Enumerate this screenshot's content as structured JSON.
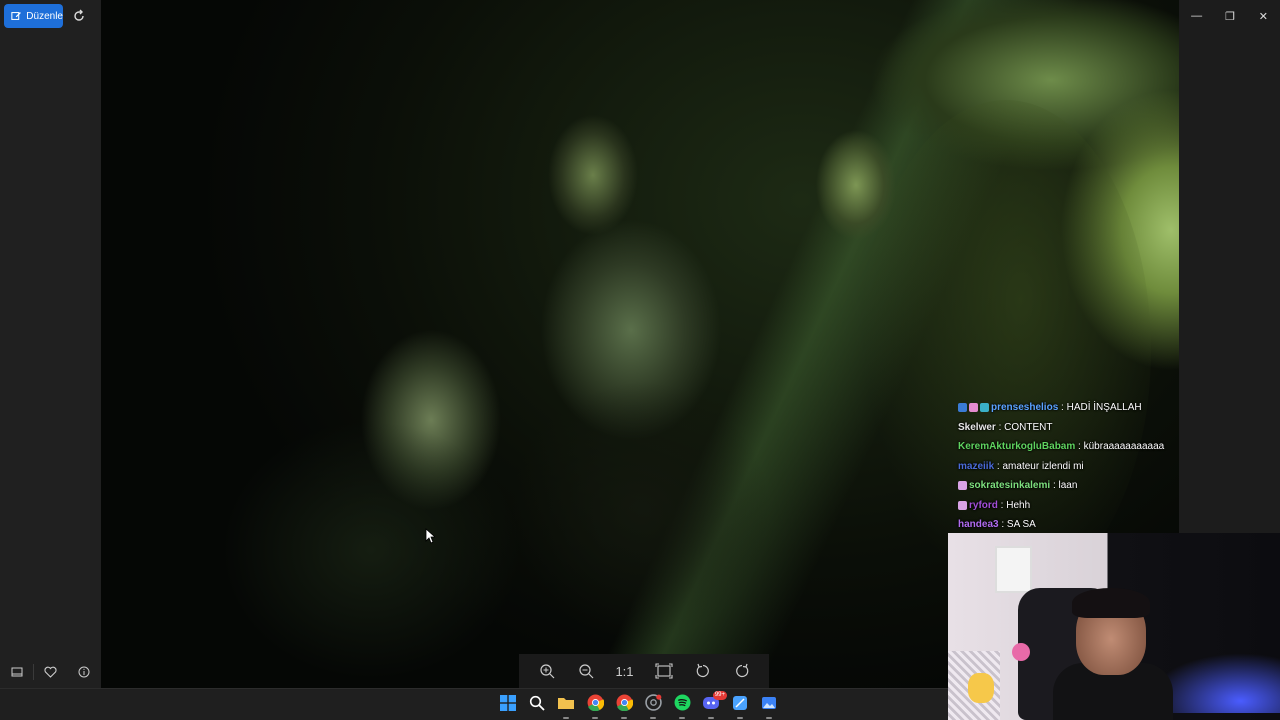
{
  "toolbar": {
    "edit_label": "Düzenle"
  },
  "chat": {
    "lines": [
      {
        "user": "prenseshelios",
        "separator": ":",
        "message": "HADİ İNŞALLAH",
        "color": "#5aa2ff",
        "badges": [
          "#3a7bd5",
          "#e58bd0",
          "#3ab0c8"
        ]
      },
      {
        "user": "Skelwer",
        "separator": ":",
        "message": "CONTENT",
        "color": "#e6e6e6",
        "badges": []
      },
      {
        "user": "KeremAkturkogluBabam",
        "separator": ":",
        "message": "kübraaaaaaaaaaa",
        "color": "#5fd35f",
        "badges": []
      },
      {
        "user": "mazeiik",
        "separator": ":",
        "message": "amateur izlendi mi",
        "color": "#4a6bd8",
        "badges": []
      },
      {
        "user": "sokratesinkalemi",
        "separator": ":",
        "message": "laan",
        "color": "#7ee07e",
        "badges": [
          "#d9a3e6"
        ]
      },
      {
        "user": "ryford",
        "separator": ":",
        "message": "Hehh",
        "color": "#a24fd8",
        "badges": [
          "#d9a3e6"
        ]
      },
      {
        "user": "handea3",
        "separator": ":",
        "message": "SA  SA",
        "color": "#b06cf0",
        "badges": []
      }
    ]
  },
  "zoom_bar": {
    "actual_size_label": "1:1"
  },
  "taskbar": {
    "apps": [
      {
        "name": "windows-start-icon",
        "color": "#3aa0ff"
      },
      {
        "name": "search-icon",
        "color": "#ffffff"
      },
      {
        "name": "file-explorer-icon",
        "color": "#f2c14e"
      },
      {
        "name": "chrome-icon",
        "color": "#ea4335"
      },
      {
        "name": "chrome-profile-icon",
        "color": "#ea4335"
      },
      {
        "name": "chrome-dev-icon",
        "color": "#9aa0a6"
      },
      {
        "name": "spotify-icon",
        "color": "#1ed760"
      },
      {
        "name": "discord-icon",
        "color": "#5865f2"
      },
      {
        "name": "snipping-tool-icon",
        "color": "#4aa3ff"
      },
      {
        "name": "photos-app-icon",
        "color": "#3b82f6"
      }
    ],
    "discord_badge": "99+"
  }
}
